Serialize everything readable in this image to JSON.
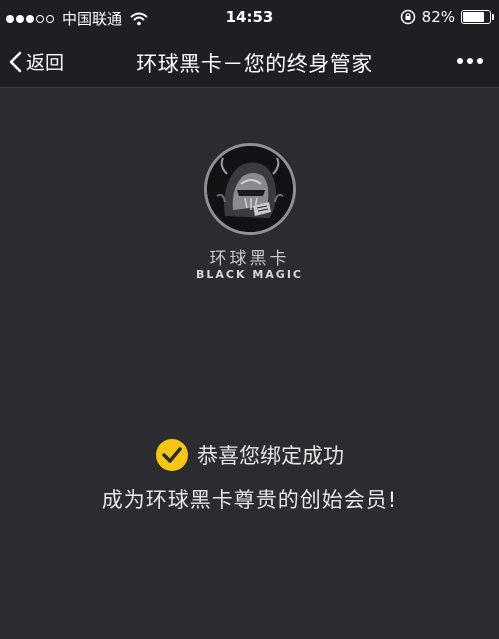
{
  "status_bar": {
    "carrier": "中国联通",
    "time": "14:53",
    "battery_percent_text": "82%",
    "battery_level": 0.82,
    "signal_bars_filled": 3,
    "signal_bars_total": 5
  },
  "nav": {
    "back_label": "返回",
    "title": "环球黑卡－您的终身管家",
    "more_icon": "more-dots-icon"
  },
  "brand": {
    "name_cn": "环球黑卡",
    "name_en": "BLACK MAGIC"
  },
  "message": {
    "success": "恭喜您绑定成功",
    "member": "成为环球黑卡尊贵的创始会员!"
  },
  "colors": {
    "background": "#2b2c30",
    "bar_background": "#1e1f22",
    "check_yellow": "#f5c518",
    "text": "#e6e6e6"
  }
}
